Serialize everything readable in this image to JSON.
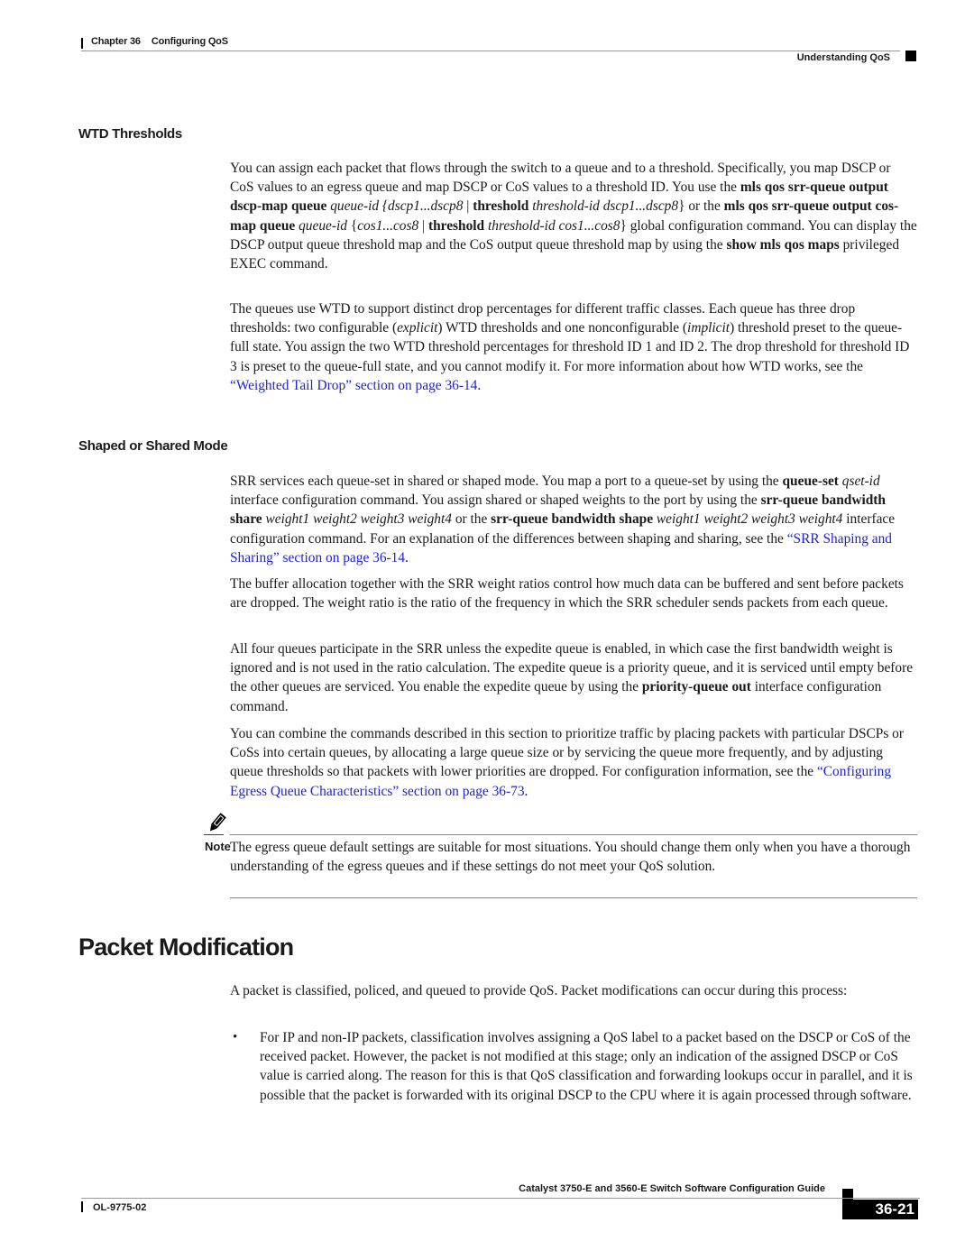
{
  "header": {
    "chapter_label": "Chapter 36",
    "chapter_title": "Configuring QoS",
    "section": "Understanding QoS"
  },
  "sections": {
    "wtd": {
      "heading": "WTD Thresholds",
      "p1": {
        "t1": "You can assign each packet that flows through the switch to a queue and to a threshold. Specifically, you map DSCP or CoS values to an egress queue and map DSCP or CoS values to a threshold ID. You use the ",
        "b1": "mls qos srr-queue output dscp-map queue",
        "i1": " queue-id {dscp1...dscp8",
        "t2": " | ",
        "b2": "threshold",
        "i2": " threshold-id dscp1...dscp8",
        "t3": "} or the ",
        "b3": "mls qos srr-queue output cos-map queue",
        "i3": " queue-id",
        "t4": " {",
        "i4": "cos1...cos8",
        "t5": " | ",
        "b4": "threshold",
        "i5": " threshold-id cos1...cos8",
        "t6": "} global configuration command. You can display the DSCP output queue threshold map and the CoS output queue threshold map by using the ",
        "b5": "show mls qos maps",
        "t7": " privileged EXEC command."
      },
      "p2": {
        "t1": "The queues use WTD to support distinct drop percentages for different traffic classes. Each queue has three drop thresholds: two configurable (",
        "i1": "explicit",
        "t2": ") WTD thresholds and one nonconfigurable (",
        "i2": "implicit",
        "t3": ") threshold preset to the queue-full state. You assign the two WTD threshold percentages for threshold ID 1 and ID 2. The drop threshold for threshold ID 3 is preset to the queue-full state, and you cannot modify it. For more information about how WTD works, see the ",
        "link": "“Weighted Tail Drop” section on page 36-14",
        "t4": "."
      }
    },
    "shaped": {
      "heading": "Shaped or Shared Mode",
      "p1": {
        "t1": "SRR services each queue-set in shared or shaped mode. You map a port to a queue-set by using the ",
        "b1": "queue-set",
        "i1": " qset-id",
        "t2": " interface configuration command. You assign shared or shaped weights to the port by using the ",
        "b2": "srr-queue bandwidth share",
        "i2": " weight1 weight2 weight3 weight4",
        "t3": " or the ",
        "b3": "srr-queue bandwidth shape",
        "i3": " weight1 weight2 weight3 weight4",
        "t4": " interface configuration command. For an explanation of the differences between shaping and sharing, see the ",
        "link": "“SRR Shaping and Sharing” section on page 36-14",
        "t5": "."
      },
      "p2": "The buffer allocation together with the SRR weight ratios control how much data can be buffered and sent before packets are dropped. The weight ratio is the ratio of the frequency in which the SRR scheduler sends packets from each queue.",
      "p3": {
        "t1": "All four queues participate in the SRR unless the expedite queue is enabled, in which case the first bandwidth weight is ignored and is not used in the ratio calculation. The expedite queue is a priority queue, and it is serviced until empty before the other queues are serviced. You enable the expedite queue by using the ",
        "b1": "priority-queue out",
        "t2": " interface configuration command."
      },
      "p4": {
        "t1": "You can combine the commands described in this section to prioritize traffic by placing packets with particular DSCPs or CoSs into certain queues, by allocating a large queue size or by servicing the queue more frequently, and by adjusting queue thresholds so that packets with lower priorities are dropped. For configuration information, see the ",
        "link": "“Configuring Egress Queue Characteristics” section on page 36-73",
        "t2": "."
      }
    },
    "note": {
      "label": "Note",
      "icon": "pencil-note-icon",
      "text": "The egress queue default settings are suitable for most situations. You should change them only when you have a thorough understanding of the egress queues and if these settings do not meet your QoS solution."
    },
    "packet_mod": {
      "heading": "Packet Modification",
      "p1": "A packet is classified, policed, and queued to provide QoS. Packet modifications can occur during this process:",
      "bullets": [
        "For IP and non-IP packets, classification involves assigning a QoS label to a packet based on the DSCP or CoS of the received packet. However, the packet is not modified at this stage; only an indication of the assigned DSCP or CoS value is carried along. The reason for this is that QoS classification and forwarding lookups occur in parallel, and it is possible that the packet is forwarded with its original DSCP to the CPU where it is again processed through software."
      ]
    }
  },
  "footer": {
    "guide_title": "Catalyst 3750-E and 3560-E Switch Software Configuration Guide",
    "doc_number": "OL-9775-02",
    "page_number": "36-21"
  },
  "colors": {
    "link": "#1f1fdc",
    "text": "#1a1a1a"
  }
}
